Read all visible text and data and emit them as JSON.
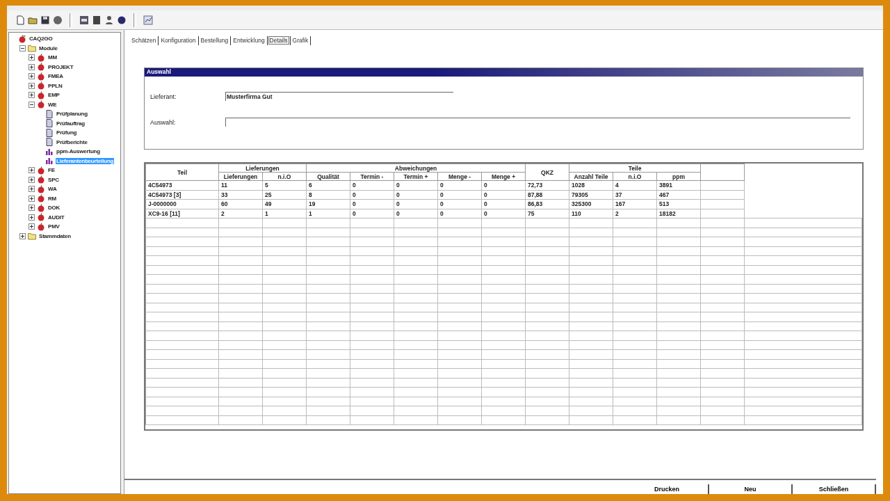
{
  "tree": [
    {
      "label": "CAQ2GO",
      "kind": "app",
      "children": [
        {
          "label": "Module",
          "kind": "folder",
          "expanded": true,
          "children": [
            {
              "label": "MM",
              "kind": "module",
              "expanded": false
            },
            {
              "label": "PROJEKT",
              "kind": "module",
              "expanded": false
            },
            {
              "label": "FMEA",
              "kind": "module",
              "expanded": false
            },
            {
              "label": "PPLN",
              "kind": "module",
              "expanded": false
            },
            {
              "label": "EMP",
              "kind": "module",
              "expanded": false
            },
            {
              "label": "WE",
              "kind": "module",
              "expanded": true,
              "children": [
                {
                  "label": "Prüfplanung",
                  "kind": "doc",
                  "selected": false
                },
                {
                  "label": "Prüfauftrag",
                  "kind": "doc",
                  "selected": false
                },
                {
                  "label": "Prüfung",
                  "kind": "doc",
                  "selected": false
                },
                {
                  "label": "Prüfberichte",
                  "kind": "doc",
                  "selected": false
                },
                {
                  "label": "ppm-Auswertung",
                  "kind": "chart",
                  "selected": false
                },
                {
                  "label": "Lieferantenbeurteilung",
                  "kind": "chart",
                  "selected": true
                }
              ]
            },
            {
              "label": "FE",
              "kind": "module",
              "expanded": false
            },
            {
              "label": "SPC",
              "kind": "module",
              "expanded": false
            },
            {
              "label": "WA",
              "kind": "module",
              "expanded": false
            },
            {
              "label": "RM",
              "kind": "module",
              "expanded": false
            },
            {
              "label": "DOK",
              "kind": "module",
              "expanded": false
            },
            {
              "label": "AUDIT",
              "kind": "module",
              "expanded": false
            },
            {
              "label": "PMV",
              "kind": "module",
              "expanded": false
            }
          ]
        },
        {
          "label": "Stammdaten",
          "kind": "folder",
          "expanded": false
        }
      ]
    }
  ],
  "tabs": [
    {
      "label": "Schätzen",
      "selected": false
    },
    {
      "label": "Konfiguration",
      "selected": false
    },
    {
      "label": "Bestellung",
      "selected": false
    },
    {
      "label": "Entwicklung",
      "selected": false
    },
    {
      "label": "Details",
      "selected": true
    },
    {
      "label": "Grafik",
      "selected": false
    }
  ],
  "auswahl": {
    "title": "Auswahl",
    "fields": [
      {
        "label": "Lieferant:",
        "value": "Musterfirma Gut",
        "kind": "short"
      },
      {
        "label": "Auswahl:",
        "kind": "long"
      }
    ]
  },
  "table": {
    "column_groups": [
      "Lieferungen",
      "Abweichungen",
      "Teile"
    ],
    "columns": [
      "Teil",
      "Lieferungen",
      "n.i.O",
      "Qualität",
      "Termin -",
      "Termin +",
      "Menge -",
      "Menge +",
      "QKZ",
      "Anzahl Teile",
      "n.i.O",
      "ppm"
    ],
    "rows": [
      [
        "4C54973",
        "11",
        "5",
        "6",
        "0",
        "0",
        "0",
        "0",
        "72,73",
        "1028",
        "4",
        "3891"
      ],
      [
        "4C54973 [3]",
        "33",
        "25",
        "8",
        "0",
        "0",
        "0",
        "0",
        "87,88",
        "79305",
        "37",
        "467"
      ],
      [
        "J-0000000",
        "60",
        "49",
        "19",
        "0",
        "0",
        "0",
        "0",
        "86,83",
        "325300",
        "167",
        "513"
      ],
      [
        "XC9-16 [11]",
        "2",
        "1",
        "1",
        "0",
        "0",
        "0",
        "0",
        "75",
        "110",
        "2",
        "18182"
      ]
    ]
  },
  "buttons": [
    "Drucken",
    "Neu",
    "Schließen"
  ]
}
